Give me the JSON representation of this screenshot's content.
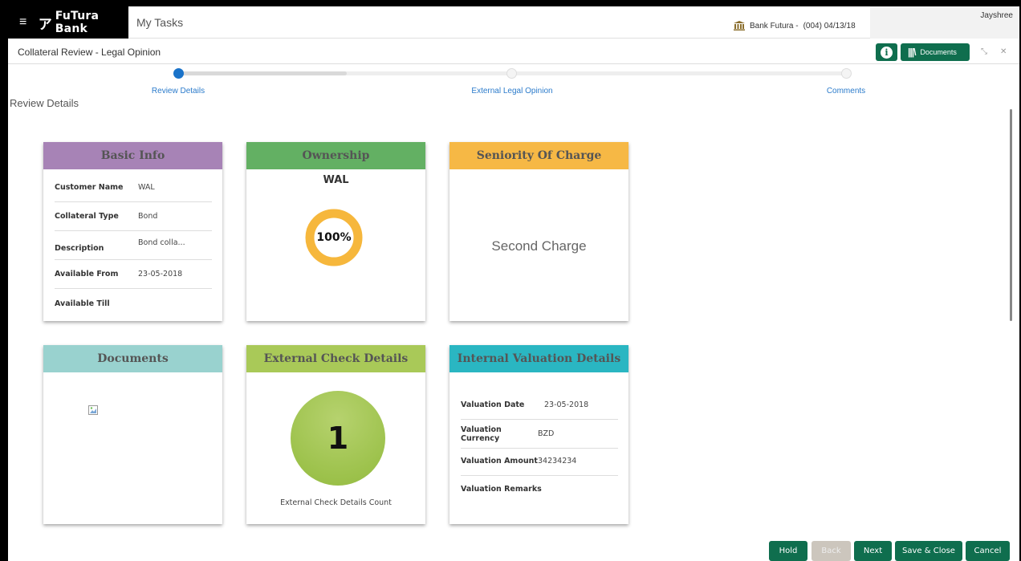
{
  "header": {
    "brand_name": "FuTura Bank",
    "logo_glyph": "ア",
    "menu_glyph": "≡",
    "app_title": "My Tasks",
    "bank_name": "Bank Futura -",
    "bank_code_date": "(004)  04/13/18",
    "user_name": "Jayshree"
  },
  "titlebar": {
    "page_title": "Collateral Review - Legal Opinion",
    "info_glyph": "i",
    "documents_label": "Documents",
    "documents_icon_glyph": "|||\\",
    "minimize_glyph": "⤡",
    "close_glyph": "✕"
  },
  "stepper": {
    "steps": [
      {
        "label": "Review Details",
        "active": true
      },
      {
        "label": "External Legal Opinion",
        "active": false
      },
      {
        "label": "Comments",
        "active": false
      }
    ]
  },
  "section_title": "Review Details",
  "cards": {
    "basic_info": {
      "title": "Basic Info",
      "color": "#a783b6",
      "fields": [
        {
          "label": "Customer Name",
          "value": "WAL"
        },
        {
          "label": "Collateral Type",
          "value": "Bond"
        },
        {
          "label": "Description",
          "value": "Bond colla..."
        },
        {
          "label": "Available From",
          "value": "23-05-2018"
        },
        {
          "label": "Available Till",
          "value": ""
        }
      ]
    },
    "ownership": {
      "title": "Ownership",
      "color": "#63b063",
      "owner": "WAL",
      "percent_label": "100%",
      "percent": 100,
      "ring_color": "#f6b73c"
    },
    "seniority": {
      "title": "Seniority Of Charge",
      "color": "#f6b845",
      "value": "Second Charge"
    },
    "documents": {
      "title": "Documents",
      "color": "#99d2cf"
    },
    "external_check": {
      "title": "External Check Details",
      "color": "#a9c958",
      "count": "1",
      "caption": "External Check Details Count"
    },
    "internal_valuation": {
      "title": "Internal Valuation Details",
      "color": "#2ab6c2",
      "fields": [
        {
          "label": "Valuation Date",
          "value": "23-05-2018"
        },
        {
          "label": "Valuation Currency",
          "value": "BZD"
        },
        {
          "label": "Valuation Amount",
          "value": "34234234"
        },
        {
          "label": "Valuation Remarks",
          "value": ""
        }
      ]
    }
  },
  "footer": {
    "hold_label": "Hold",
    "back_label": "Back",
    "next_label": "Next",
    "save_close_label": "Save & Close",
    "cancel_label": "Cancel"
  },
  "colors": {
    "accent": "#0f6e4e",
    "step_active": "#1a73c9",
    "link": "#2b7bcb"
  }
}
